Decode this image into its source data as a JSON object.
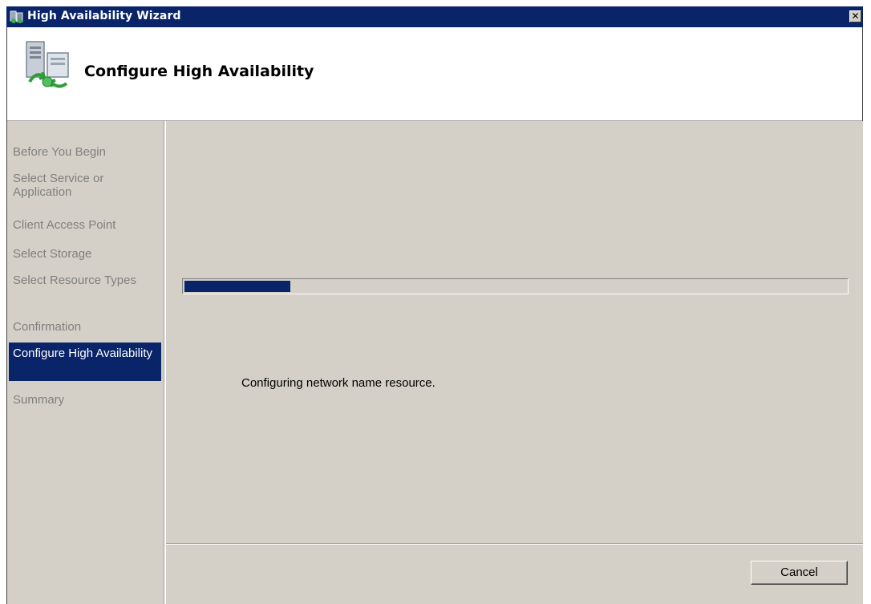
{
  "window": {
    "title": "High Availability Wizard",
    "close_glyph": "✕"
  },
  "header": {
    "heading": "Configure High Availability",
    "icon": "server-cluster-icon"
  },
  "nav": {
    "items": [
      {
        "label": "Before You Begin",
        "active": false
      },
      {
        "label": "Select Service or Application",
        "active": false
      },
      {
        "label": "Client Access Point",
        "active": false
      },
      {
        "label": "Select Storage",
        "active": false
      },
      {
        "label": "Select Resource Types",
        "active": false
      },
      {
        "label": "Confirmation",
        "active": false
      },
      {
        "label": "Configure High Availability",
        "active": true
      },
      {
        "label": "Summary",
        "active": false
      }
    ]
  },
  "main": {
    "progress_percent": 16,
    "status_text": "Configuring network name resource."
  },
  "footer": {
    "cancel_label": "Cancel"
  },
  "colors": {
    "titlebar": "#0a246a",
    "selection": "#0a246a",
    "dialog_bg": "#d4d0c8",
    "disabled_text": "#808080"
  }
}
